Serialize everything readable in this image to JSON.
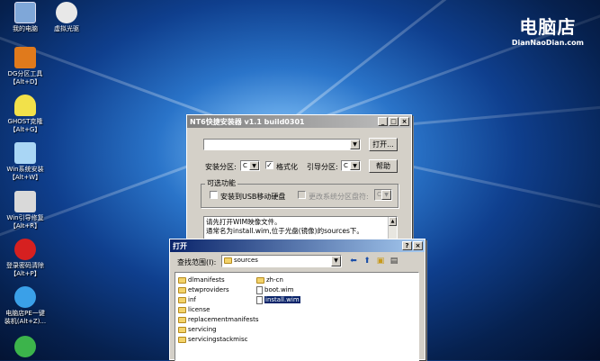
{
  "desktop": {
    "icons": [
      {
        "label": "我的电脑",
        "icon": "computer-icon",
        "color": "#7fa7d8"
      },
      {
        "label": "虚拟光驱",
        "icon": "virtual-drive-icon",
        "color": "#e8e8e8"
      },
      {
        "label": "DG分区工具\n【Alt+D】",
        "icon": "partition-tool-icon",
        "color": "#e07a1c"
      },
      {
        "label": "GHOST克隆\n【Alt+G】",
        "icon": "ghost-icon",
        "color": "#f2e14a"
      },
      {
        "label": "Win系统安装\n【Alt+W】",
        "icon": "win-install-icon",
        "color": "#a9d6f5"
      },
      {
        "label": "Win引导修复\n【Alt+R】",
        "icon": "boot-repair-icon",
        "color": "#d9d9d9"
      },
      {
        "label": "登录密码清除\n【Alt+P】",
        "icon": "password-clear-icon",
        "color": "#d62020"
      },
      {
        "label": "电脑店PE一键\n装机(Alt+Z)...",
        "icon": "pe-install-icon",
        "color": "#3aa0e8"
      },
      {
        "label": "",
        "icon": "globe-icon",
        "color": "#3cb44b"
      }
    ]
  },
  "logo": {
    "main": "电脑店",
    "sub": "DianNaoDian.com"
  },
  "nt6": {
    "title": "NT6快捷安装器 v1.1 build0301",
    "open_btn": "打开...",
    "install_part_label": "安装分区:",
    "install_part_value": "C",
    "format_label": "格式化",
    "format_checked": "✓",
    "boot_part_label": "引导分区:",
    "boot_part_value": "C",
    "help_btn": "帮助",
    "options_title": "可选功能",
    "usb_label": "安装到USB移动硬盘",
    "change_drive_label": "更改系统分区盘符:",
    "change_drive_value": "C",
    "msg_line1": "请先打开WIM映像文件。",
    "msg_line2": "通常名为install.wim,位于光盘(镜像)的sources下。"
  },
  "open_dialog": {
    "title": "打开",
    "lookin_label": "查找范围(I):",
    "lookin_value": "sources",
    "folders_col1": [
      "dlmanifests",
      "etwproviders",
      "inf",
      "license",
      "replacementmanifests",
      "servicing",
      "servicingstackmisc"
    ],
    "items_col2": [
      {
        "name": "zh-cn",
        "type": "folder"
      },
      {
        "name": "boot.wim",
        "type": "file"
      },
      {
        "name": "install.wim",
        "type": "file",
        "selected": true
      }
    ]
  }
}
